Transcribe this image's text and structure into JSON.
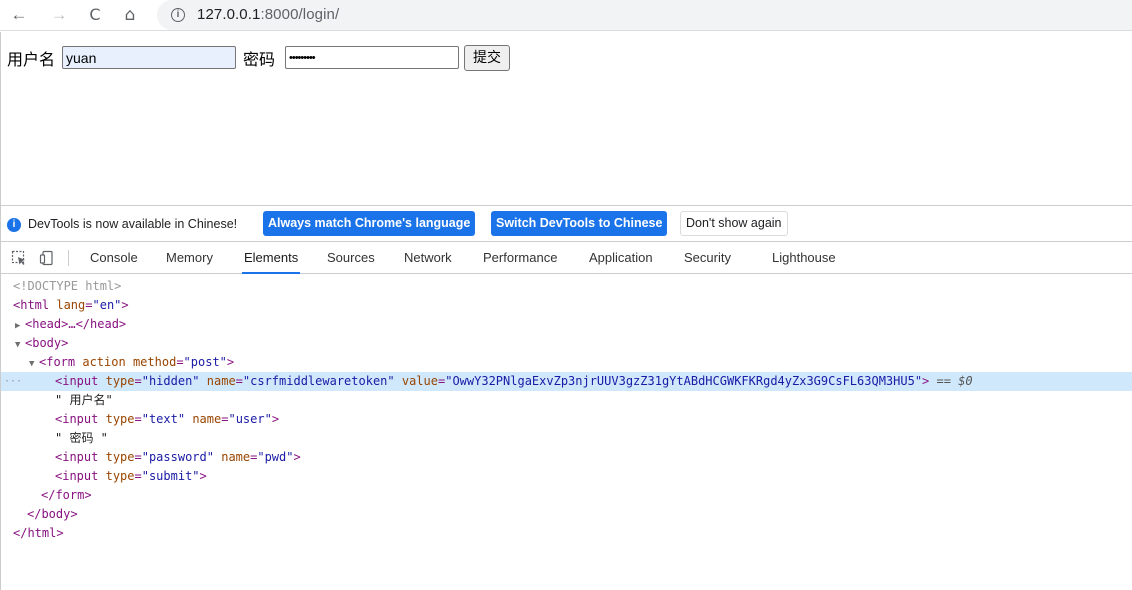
{
  "browser": {
    "back_icon": "←",
    "forward_icon": "→",
    "reload_icon": "C",
    "home_icon": "⌂",
    "info_icon": "i",
    "url_host": "127.0.0.1",
    "url_rest": ":8000/login/"
  },
  "page": {
    "username_label": "用户名",
    "username_value": "yuan",
    "password_label": "密码",
    "password_value": "•••••••••",
    "submit_label": "提交"
  },
  "devtools": {
    "info_message": "DevTools is now available in Chinese!",
    "match_language_button": "Always match Chrome's language",
    "switch_chinese_button": "Switch DevTools to Chinese",
    "dont_show_button": "Don't show again",
    "tabs": [
      "Console",
      "Memory",
      "Elements",
      "Sources",
      "Network",
      "Performance",
      "Application",
      "Security",
      "Lighthouse"
    ],
    "active_tab": "Elements",
    "accent_color": "#1a73e8",
    "dom": {
      "doctype": "<!DOCTYPE html>",
      "html_open_tag": "<html",
      "html_lang_attr": "lang",
      "html_lang_val": "\"en\"",
      "head_collapsed": "<head>…</head>",
      "body_open": "<body>",
      "form_tag": "<form",
      "form_action": "action",
      "form_method_attr": "method",
      "form_method_val": "\"post\"",
      "input_tag": "<input",
      "type_attr": "type",
      "name_attr": "name",
      "value_attr": "value",
      "hidden_type": "\"hidden\"",
      "csrf_name": "\"csrfmiddlewaretoken\"",
      "csrf_value": "\"OwwY32PNlgaExvZp3njrUUV3gzZ31gYtABdHCGWKFKRgd4yZx3G9CsFL63QM3HU5\"",
      "selected_marker": "== $0",
      "text_username": "\" 用户名\"",
      "text_type": "\"text\"",
      "user_name": "\"user\"",
      "text_password": "\" 密码 \"",
      "password_type": "\"password\"",
      "pwd_name": "\"pwd\"",
      "submit_type": "\"submit\"",
      "form_close": "</form>",
      "body_close": "</body>",
      "html_close": "</html>"
    }
  }
}
